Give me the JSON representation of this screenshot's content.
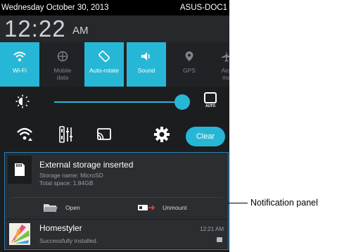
{
  "status_bar": {
    "date": "Wednesday October 30, 2013",
    "device": "ASUS-DOC1"
  },
  "clock": {
    "time": "12:22",
    "ampm": "AM"
  },
  "quick_settings": [
    {
      "id": "wifi",
      "label": "Wi-Fi",
      "state": "on",
      "icon": "wifi-icon"
    },
    {
      "id": "mobile-data",
      "label": "Mobile\ndata",
      "state": "off",
      "icon": "globe-icon"
    },
    {
      "id": "auto-rotate",
      "label": "Auto-rotate",
      "state": "on",
      "icon": "rotate-icon"
    },
    {
      "id": "sound",
      "label": "Sound",
      "state": "on",
      "icon": "speaker-icon"
    },
    {
      "id": "gps",
      "label": "GPS",
      "state": "off",
      "icon": "gps-icon"
    },
    {
      "id": "airplane",
      "label": "Airp\nma",
      "state": "off",
      "icon": "airplane-icon"
    }
  ],
  "brightness": {
    "level": 0.93,
    "auto_label": "AUTO"
  },
  "toolbar": {
    "clear_label": "Clear"
  },
  "notifications": [
    {
      "title": "External storage inserted",
      "lines": [
        "Storage name: MicroSD",
        "Total space: 1.84GB"
      ],
      "actions": [
        "Open",
        "Unmount"
      ],
      "icon": "sd-card-icon"
    },
    {
      "title": "Homestyler",
      "subtitle": "Successfully installed.",
      "time": "12:21 AM",
      "icon": "homestyler-app-icon"
    }
  ],
  "callout": {
    "label": "Notification panel"
  },
  "colors": {
    "accent": "#27b7d6",
    "panel_bg": "#1c1d1f",
    "notification_bg": "#2b2d30",
    "highlight_border": "#2b7fb5"
  }
}
